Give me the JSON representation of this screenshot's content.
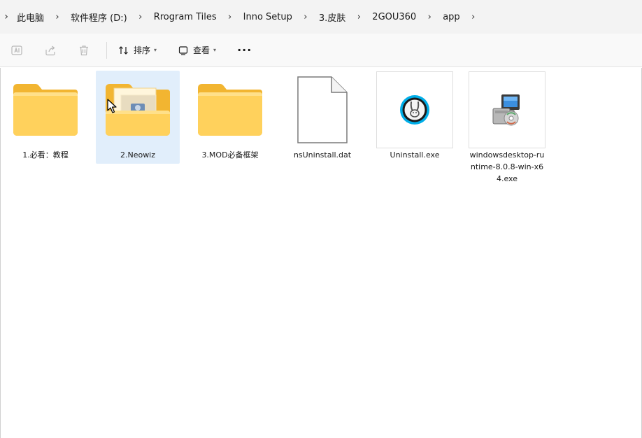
{
  "address_bar": {
    "leading_chevron": "›",
    "separator": "›",
    "breadcrumbs": [
      "此电脑",
      "软件程序 (D:)",
      "Rrogram Tiles",
      "Inno Setup",
      "3.皮肤",
      "2GOU360",
      "app"
    ]
  },
  "toolbar": {
    "icons": [
      "rename-icon",
      "share-icon",
      "delete-icon"
    ],
    "sort_label": "排序",
    "view_label": "查看",
    "more_label": "···"
  },
  "files": [
    {
      "name": "1.必看：教程",
      "kind": "folder",
      "selected": false
    },
    {
      "name": "2.Neowiz",
      "kind": "folder-with-content",
      "selected": true
    },
    {
      "name": "3.MOD必备框架",
      "kind": "folder",
      "selected": false
    },
    {
      "name": "nsUninstall.dat",
      "kind": "document",
      "selected": false
    },
    {
      "name": "Uninstall.exe",
      "kind": "exe-rabbit",
      "selected": false
    },
    {
      "name": "windowsdesktop-runtime-8.0.8-win-x64.exe",
      "kind": "exe-installer",
      "selected": false
    }
  ],
  "colors": {
    "folder_back": "#f2b531",
    "folder_front": "#ffd15c",
    "selection": "#e1eefb",
    "accent": "#00aee8"
  }
}
